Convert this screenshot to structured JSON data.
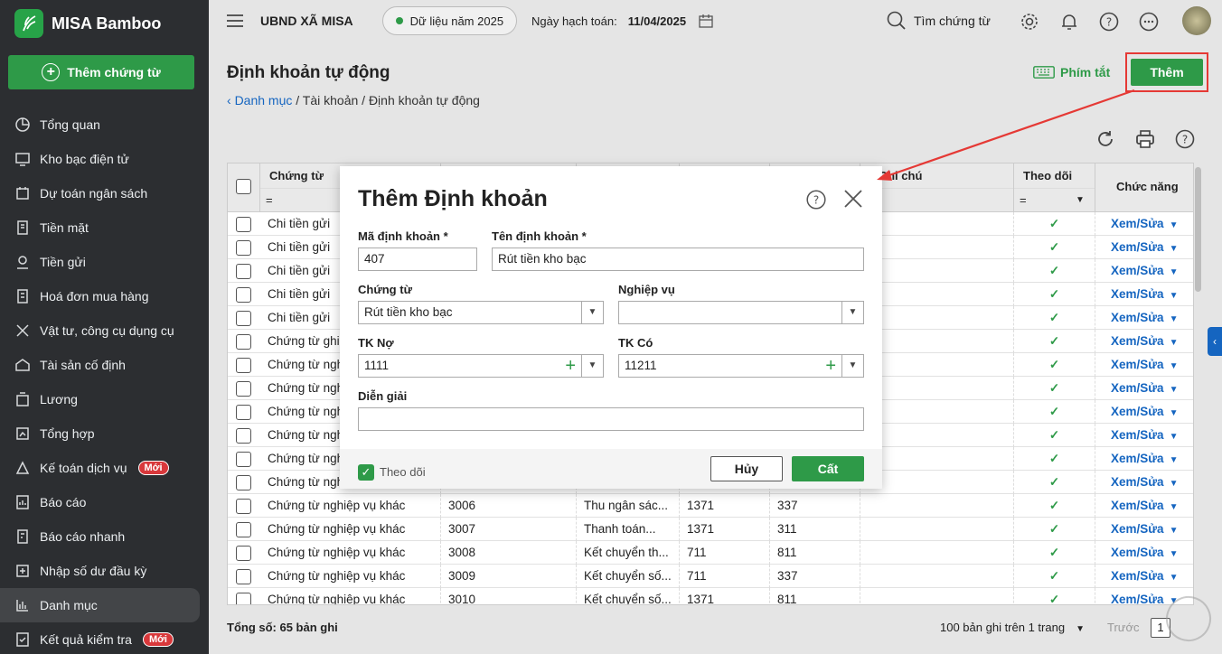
{
  "app": {
    "name": "MISA Bamboo",
    "add_voucher_label": "Thêm chứng từ"
  },
  "sidebar": {
    "items": [
      {
        "label": "Tổng quan",
        "icon": "pie-chart-icon"
      },
      {
        "label": "Kho bạc điện tử",
        "icon": "monitor-icon"
      },
      {
        "label": "Dự toán ngân sách",
        "icon": "budget-icon"
      },
      {
        "label": "Tiền mặt",
        "icon": "cash-icon"
      },
      {
        "label": "Tiền gửi",
        "icon": "deposit-icon"
      },
      {
        "label": "Hoá đơn mua hàng",
        "icon": "invoice-icon"
      },
      {
        "label": "Vật tư, công cụ dụng cụ",
        "icon": "tools-icon"
      },
      {
        "label": "Tài sản cố định",
        "icon": "building-icon"
      },
      {
        "label": "Lương",
        "icon": "salary-icon"
      },
      {
        "label": "Tổng hợp",
        "icon": "summary-icon"
      },
      {
        "label": "Kế toán dịch vụ",
        "icon": "service-icon",
        "badge": "Mới"
      },
      {
        "label": "Báo cáo",
        "icon": "report-icon"
      },
      {
        "label": "Báo cáo nhanh",
        "icon": "quick-report-icon"
      },
      {
        "label": "Nhập số dư đầu kỳ",
        "icon": "import-icon"
      },
      {
        "label": "Danh mục",
        "icon": "catalog-icon",
        "active": true
      },
      {
        "label": "Kết quả kiểm tra",
        "icon": "check-result-icon",
        "badge": "Mới"
      }
    ]
  },
  "topbar": {
    "org": "UBND XÃ MISA",
    "data_year": "Dữ liệu năm 2025",
    "date_label": "Ngày hạch toán:",
    "date_value": "11/04/2025",
    "search_label": "Tìm chứng từ"
  },
  "page": {
    "title": "Định khoản tự động",
    "breadcrumb_link": "Danh mục",
    "breadcrumb_rest": " / Tài khoản / Định khoản tự động",
    "shortcut_label": "Phím tắt",
    "add_label": "Thêm"
  },
  "grid": {
    "columns": {
      "voucher": "Chứng từ",
      "note": "Ghi chú",
      "track": "Theo dõi",
      "action": "Chức năng",
      "filter_eq": "="
    },
    "rows": [
      {
        "voucher": "Chi tiền gửi",
        "code": "",
        "desc": "",
        "debit": "",
        "credit": "",
        "track": "✓",
        "action": "Xem/Sửa"
      },
      {
        "voucher": "Chi tiền gửi",
        "code": "",
        "desc": "",
        "debit": "",
        "credit": "",
        "track": "✓",
        "action": "Xem/Sửa"
      },
      {
        "voucher": "Chi tiền gửi",
        "code": "",
        "desc": "",
        "debit": "",
        "credit": "",
        "track": "✓",
        "action": "Xem/Sửa"
      },
      {
        "voucher": "Chi tiền gửi",
        "code": "",
        "desc": "",
        "debit": "",
        "credit": "",
        "track": "✓",
        "action": "Xem/Sửa"
      },
      {
        "voucher": "Chi tiền gửi",
        "code": "",
        "desc": "",
        "debit": "",
        "credit": "",
        "track": "✓",
        "action": "Xem/Sửa"
      },
      {
        "voucher": "Chứng từ ghi",
        "code": "",
        "desc": "",
        "debit": "",
        "credit": "",
        "track": "✓",
        "action": "Xem/Sửa"
      },
      {
        "voucher": "Chứng từ ngh",
        "code": "",
        "desc": "",
        "debit": "",
        "credit": "",
        "track": "✓",
        "action": "Xem/Sửa"
      },
      {
        "voucher": "Chứng từ ngh",
        "code": "",
        "desc": "",
        "debit": "",
        "credit": "",
        "track": "✓",
        "action": "Xem/Sửa"
      },
      {
        "voucher": "Chứng từ ngh",
        "code": "",
        "desc": "",
        "debit": "",
        "credit": "",
        "track": "✓",
        "action": "Xem/Sửa"
      },
      {
        "voucher": "Chứng từ ngh",
        "code": "",
        "desc": "",
        "debit": "",
        "credit": "",
        "track": "✓",
        "action": "Xem/Sửa"
      },
      {
        "voucher": "Chứng từ ngh",
        "code": "",
        "desc": "",
        "debit": "",
        "credit": "",
        "track": "✓",
        "action": "Xem/Sửa"
      },
      {
        "voucher": "Chứng từ ngh",
        "code": "",
        "desc": "",
        "debit": "",
        "credit": "",
        "track": "✓",
        "action": "Xem/Sửa"
      },
      {
        "voucher": "Chứng từ nghiệp vụ khác",
        "code": "3006",
        "desc": "Thu ngân sác...",
        "debit": "1371",
        "credit": "337",
        "track": "✓",
        "action": "Xem/Sửa"
      },
      {
        "voucher": "Chứng từ nghiệp vụ khác",
        "code": "3007",
        "desc": "Thanh toán...",
        "debit": "1371",
        "credit": "311",
        "track": "✓",
        "action": "Xem/Sửa"
      },
      {
        "voucher": "Chứng từ nghiệp vụ khác",
        "code": "3008",
        "desc": "Kết chuyển th...",
        "debit": "711",
        "credit": "811",
        "track": "✓",
        "action": "Xem/Sửa"
      },
      {
        "voucher": "Chứng từ nghiệp vụ khác",
        "code": "3009",
        "desc": "Kết chuyển số...",
        "debit": "711",
        "credit": "337",
        "track": "✓",
        "action": "Xem/Sửa"
      },
      {
        "voucher": "Chứng từ nghiệp vụ khác",
        "code": "3010",
        "desc": "Kết chuyển số...",
        "debit": "1371",
        "credit": "811",
        "track": "✓",
        "action": "Xem/Sửa"
      }
    ]
  },
  "footer": {
    "total": "Tổng số: 65 bản ghi",
    "per_page": "100 bản ghi trên 1 trang",
    "prev": "Trước",
    "page": "1"
  },
  "dialog": {
    "title": "Thêm Định khoản",
    "code_label": "Mã định khoản *",
    "code_value": "407",
    "name_label": "Tên định khoản *",
    "name_value": "Rút tiền kho bạc",
    "voucher_label": "Chứng từ",
    "voucher_value": "Rút tiền kho bạc",
    "business_label": "Nghiệp vụ",
    "business_value": "",
    "debit_label": "TK Nợ",
    "debit_value": "1111",
    "credit_label": "TK Có",
    "credit_value": "11211",
    "desc_label": "Diễn giải",
    "desc_value": "",
    "track_label": "Theo dõi",
    "cancel_label": "Hủy",
    "save_label": "Cất"
  },
  "colors": {
    "brand_green": "#2e9a48",
    "link_blue": "#1565c0",
    "highlight_red": "#e53935",
    "sidebar_bg": "#2c2e31"
  }
}
